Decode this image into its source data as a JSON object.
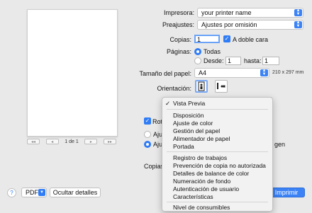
{
  "preview": {
    "page_indicator": "1 de 1"
  },
  "printer": {
    "label": "Impresora:",
    "value": "your printer name"
  },
  "presets": {
    "label": "Preajustes:",
    "value": "Ajustes por omisión"
  },
  "copies": {
    "label": "Copias:",
    "value": "1",
    "duplex_label": "A doble cara"
  },
  "pages": {
    "label": "Páginas:",
    "all_label": "Todas",
    "from_label": "Desde:",
    "from_value": "1",
    "to_label": "hasta:",
    "to_value": "1"
  },
  "paper_size": {
    "label": "Tamaño del papel:",
    "value": "A4",
    "dimensions": "210 x 297 mm"
  },
  "orientation": {
    "label": "Orientación:"
  },
  "behind": {
    "rotate_partial": "Rotac",
    "adjust1_partial": "Ajust",
    "adjust2_partial": "Ajust",
    "image_partial": "gen",
    "copies_partial": "Copias p"
  },
  "menu": {
    "groups": [
      [
        "Vista Previa"
      ],
      [
        "Disposición",
        "Ajuste de color",
        "Gestión del papel",
        "Alimentador de papel",
        "Portada"
      ],
      [
        "Registro de trabajos",
        "Prevención de copia no autorizada",
        "Detalles de balance de color",
        "Numeración de fondo",
        "Autenticación de usuario",
        "Características"
      ],
      [
        "Nivel de consumibles"
      ]
    ],
    "checked_item": "Vista Previa"
  },
  "footer": {
    "help": "?",
    "pdf_label": "PDF",
    "hide_details": "Ocultar detalles",
    "print": "Imprimir"
  }
}
